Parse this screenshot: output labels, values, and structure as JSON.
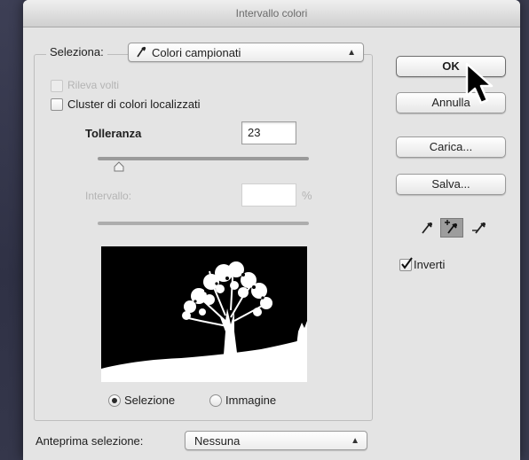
{
  "dialog": {
    "title": "Intervallo colori"
  },
  "selection": {
    "label": "Seleziona:",
    "value": "Colori campionati",
    "icon": "eyedropper-icon"
  },
  "options": {
    "detect_faces": {
      "label": "Rileva volti",
      "checked": false,
      "enabled": false
    },
    "localized_clusters": {
      "label": "Cluster di colori localizzati",
      "checked": false,
      "enabled": true
    }
  },
  "fuzziness": {
    "label": "Tolleranza",
    "value": "23"
  },
  "range": {
    "label": "Intervallo:",
    "value": "",
    "unit": "%",
    "enabled": false
  },
  "preview": {
    "radio_selection": "Selezione",
    "radio_image": "Immagine",
    "selected": "Selezione"
  },
  "buttons": {
    "ok": "OK",
    "cancel": "Annulla",
    "load": "Carica...",
    "save": "Salva..."
  },
  "eyedroppers": {
    "sample": "eyedropper-icon",
    "add": "eyedropper-plus-icon",
    "subtract": "eyedropper-minus-icon",
    "active": "add"
  },
  "invert": {
    "label": "Inverti",
    "checked": true
  },
  "selection_preview": {
    "label": "Anteprima selezione:",
    "value": "Nessuna"
  },
  "colors": {
    "dialog_bg": "#e4e4e4",
    "desktop_bg": "#3b3d52",
    "preview_bg": "#000000"
  }
}
